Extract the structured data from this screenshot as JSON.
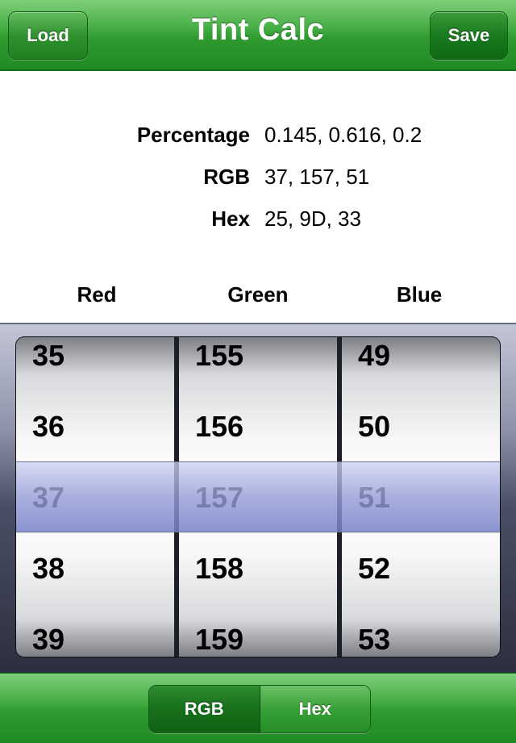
{
  "nav": {
    "title": "Tint Calc",
    "load_label": "Load",
    "save_label": "Save"
  },
  "info": {
    "rows": [
      {
        "label": "Percentage",
        "value": "0.145, 0.616, 0.2"
      },
      {
        "label": "RGB",
        "value": "37, 157, 51"
      },
      {
        "label": "Hex",
        "value": "25, 9D, 33"
      }
    ]
  },
  "columns": {
    "red": "Red",
    "green": "Green",
    "blue": "Blue"
  },
  "picker": {
    "red": {
      "items": [
        "35",
        "36",
        "37",
        "38",
        "39"
      ],
      "selected": "37"
    },
    "green": {
      "items": [
        "155",
        "156",
        "157",
        "158",
        "159"
      ],
      "selected": "157"
    },
    "blue": {
      "items": [
        "49",
        "50",
        "51",
        "52",
        "53"
      ],
      "selected": "51"
    }
  },
  "toolbar": {
    "rgb_label": "RGB",
    "hex_label": "Hex",
    "active": "RGB"
  },
  "colors": {
    "accent": "#2f9a30",
    "selection": "#9aa2d8"
  }
}
